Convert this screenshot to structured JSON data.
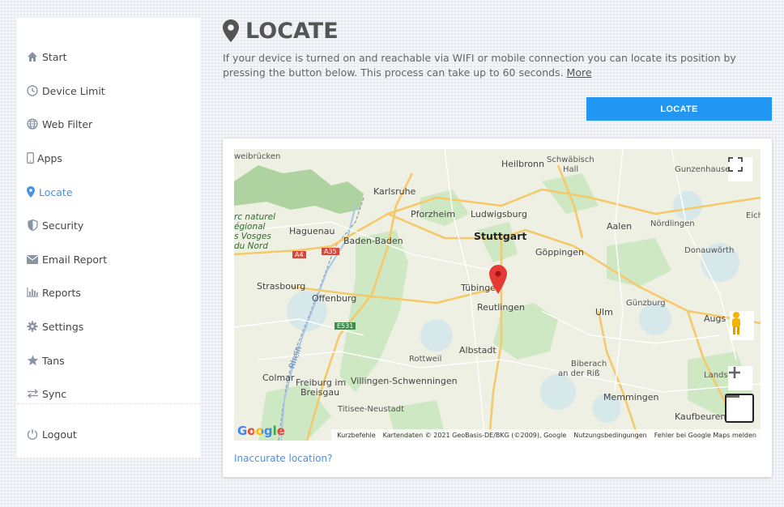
{
  "sidebar": {
    "items": [
      {
        "label": "Start",
        "icon": "home-icon"
      },
      {
        "label": "Device Limit",
        "icon": "clock-icon"
      },
      {
        "label": "Web Filter",
        "icon": "globe-icon"
      },
      {
        "label": "Apps",
        "icon": "phone-icon"
      },
      {
        "label": "Locate",
        "icon": "map-pin-icon",
        "active": true
      },
      {
        "label": "Security",
        "icon": "shield-icon"
      },
      {
        "label": "Email Report",
        "icon": "envelope-icon"
      },
      {
        "label": "Reports",
        "icon": "bar-chart-icon"
      },
      {
        "label": "Settings",
        "icon": "gear-icon"
      },
      {
        "label": "Tans",
        "icon": "star-icon"
      },
      {
        "label": "Sync",
        "icon": "sync-icon"
      }
    ],
    "logout": "Logout"
  },
  "header": {
    "title": "LOCATE",
    "intro": "If your device is turned on and reachable via WIFI or mobile connection you can locate its position by pressing the button below. This process can take up to 60 seconds.",
    "more_link": "More"
  },
  "locate_button": "LOCATE",
  "map": {
    "labels": {
      "saarbrucken": "weibrücken",
      "heilbronn": "Heilbronn",
      "schwabisch": "Schwäbisch",
      "hall": "Hall",
      "gunzenhausen": "Gunzenhause",
      "karlsruhe": "Karlsruhe",
      "pforzheim": "Pforzheim",
      "ludwigsburg": "Ludwigsburg",
      "aalen": "Aalen",
      "nordlingen": "Nördlingen",
      "eich": "Eich",
      "vosges1": "rc naturel",
      "vosges2": "égional",
      "vosges3": "s Vosges",
      "vosges4": "du Nord",
      "haguenau": "Haguenau",
      "baden": "Baden-Baden",
      "stuttgart": "Stuttgart",
      "goppingen": "Göppingen",
      "donauworth": "Donauwörth",
      "strasbourg": "Strasbourg",
      "tubingen": "Tübinge",
      "reutlingen": "Reutlingen",
      "offenburg": "Offenburg",
      "ulm": "Ulm",
      "gunzburg": "Günzburg",
      "augsburg": "Augs",
      "albstadt": "Albstadt",
      "rottweil": "Rottweil",
      "biberach1": "Biberach",
      "biberach2": "an der Riß",
      "colmar": "Colmar",
      "freiburg1": "Freiburg im",
      "freiburg2": "Breisgau",
      "villingen": "Villingen-Schwenningen",
      "titisee": "Titisee-Neustadt",
      "memmingen": "Memmingen",
      "landsberg": "Lands",
      "kaufbeuren": "Kaufbeuren",
      "rhein": "Rhein",
      "a4": "A4",
      "a35": "A35",
      "e531": "E531"
    },
    "attribution": {
      "shortcuts": "Kurzbefehle",
      "data": "Kartendaten © 2021 GeoBasis-DE/BKG (©2009), Google",
      "terms": "Nutzungsbedingungen",
      "report": "Fehler bei Google Maps melden"
    },
    "google_logo": "Google"
  },
  "inaccurate_link": "Inaccurate location?",
  "colors": {
    "accent": "#2196f3",
    "active_nav": "#4a90e2",
    "pin": "#e53935"
  }
}
